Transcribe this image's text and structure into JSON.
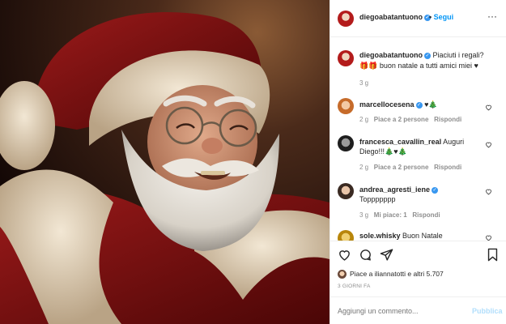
{
  "post": {
    "username": "diegoabatantuono",
    "follow_label": "Segui",
    "more_label": "···",
    "caption_text": "Piaciuti i regali? 🎁🎁 buon natale a tutti amici miei ♥",
    "caption_line1": "Piaciuti i regali?",
    "caption_line2": "🎁🎁 buon natale a tutti amici miei ♥",
    "caption_age": "3 g"
  },
  "comments": [
    {
      "username": "marcellocesena",
      "verified": true,
      "text": "♥🎄",
      "age": "2 g",
      "likes": "Piace a 2 persone",
      "reply": "Rispondi"
    },
    {
      "username": "francesca_cavallin_real",
      "verified": false,
      "text_line1": "Auguri",
      "text_line2": "Diego!!!🎄♥🎄",
      "age": "2 g",
      "likes": "Piace a 2 persone",
      "reply": "Rispondi"
    },
    {
      "username": "andrea_agresti_iene",
      "verified": true,
      "text": "Toppppppp",
      "age": "3 g",
      "likes": "Mi piace: 1",
      "reply": "Rispondi"
    },
    {
      "username": "sole.whisky",
      "verified": false,
      "text": "Buon Natale"
    }
  ],
  "actions": {
    "likes_text": "Piace a iliannatotti e altri 5.707",
    "timestamp": "3 GIORNI FA"
  },
  "add_comment": {
    "placeholder": "Aggiungi un commento...",
    "publish_label": "Pubblica"
  },
  "colors": {
    "accent": "#0095f6",
    "verified": "#3897f0",
    "text": "#262626",
    "muted": "#8e8e8e"
  }
}
